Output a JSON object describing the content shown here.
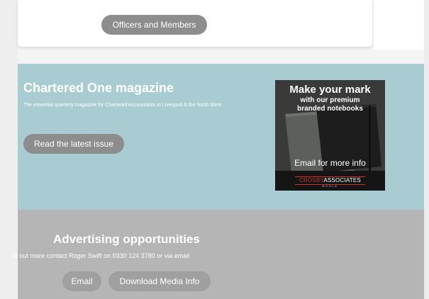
{
  "top": {
    "officers_label": "Officers and Members"
  },
  "magazine": {
    "title": "Chartered One magazine",
    "description": "The essential quarterly magazine for Chartered Accountants in Liverpool & the North West",
    "read_label": "Read the latest issue"
  },
  "ad_banner": {
    "headline": "Make your mark",
    "sub_line1": "with our premium",
    "sub_line2": "branded notebooks",
    "cta": "Email for more info",
    "logo_part1": "CROSBY",
    "logo_part2": "ASSOCIATES",
    "logo_sub": "MEDIA"
  },
  "advertising": {
    "title": "Advertising opportunities",
    "text": "nd out more contact Roger Swift on 0330 124 3780 or via email",
    "email_label": "Email",
    "media_label": "Download Media Info"
  },
  "colors": {
    "button_grey": "#8d8d8d",
    "magazine_bg": "#a9ccd3",
    "advert_bg": "#b5b5b5",
    "brand_red": "#d0312d"
  }
}
